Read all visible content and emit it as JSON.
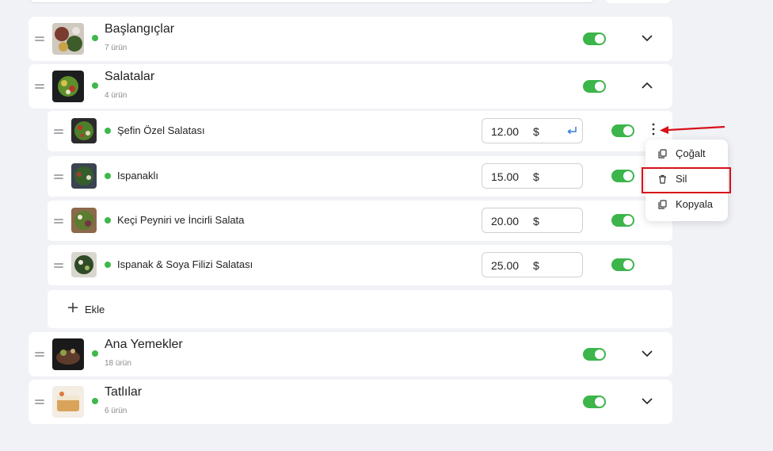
{
  "categories": [
    {
      "title": "Başlangıçlar",
      "count": "7 ürün",
      "expanded": false
    },
    {
      "title": "Salatalar",
      "count": "4 ürün",
      "expanded": true
    },
    {
      "title": "Ana Yemekler",
      "count": "18 ürün",
      "expanded": false
    },
    {
      "title": "Tatlılar",
      "count": "6 ürün",
      "expanded": false
    }
  ],
  "items": [
    {
      "name": "Şefin Özel Salatası",
      "price": "12.00",
      "currency": "$"
    },
    {
      "name": "Ispanaklı",
      "price": "15.00",
      "currency": "$"
    },
    {
      "name": "Keçi Peyniri ve İncirli Salata",
      "price": "20.00",
      "currency": "$"
    },
    {
      "name": "Ispanak & Soya Filizi Salatası",
      "price": "25.00",
      "currency": "$"
    }
  ],
  "add_label": "Ekle",
  "context_menu": [
    {
      "label": "Çoğalt",
      "icon": "copy-icon"
    },
    {
      "label": "Sil",
      "icon": "trash-icon"
    },
    {
      "label": "Kopyala",
      "icon": "copy-icon"
    }
  ],
  "colors": {
    "active": "#3cb54a",
    "annotation": "#d8111a",
    "accent_blue": "#3a7bd5"
  }
}
